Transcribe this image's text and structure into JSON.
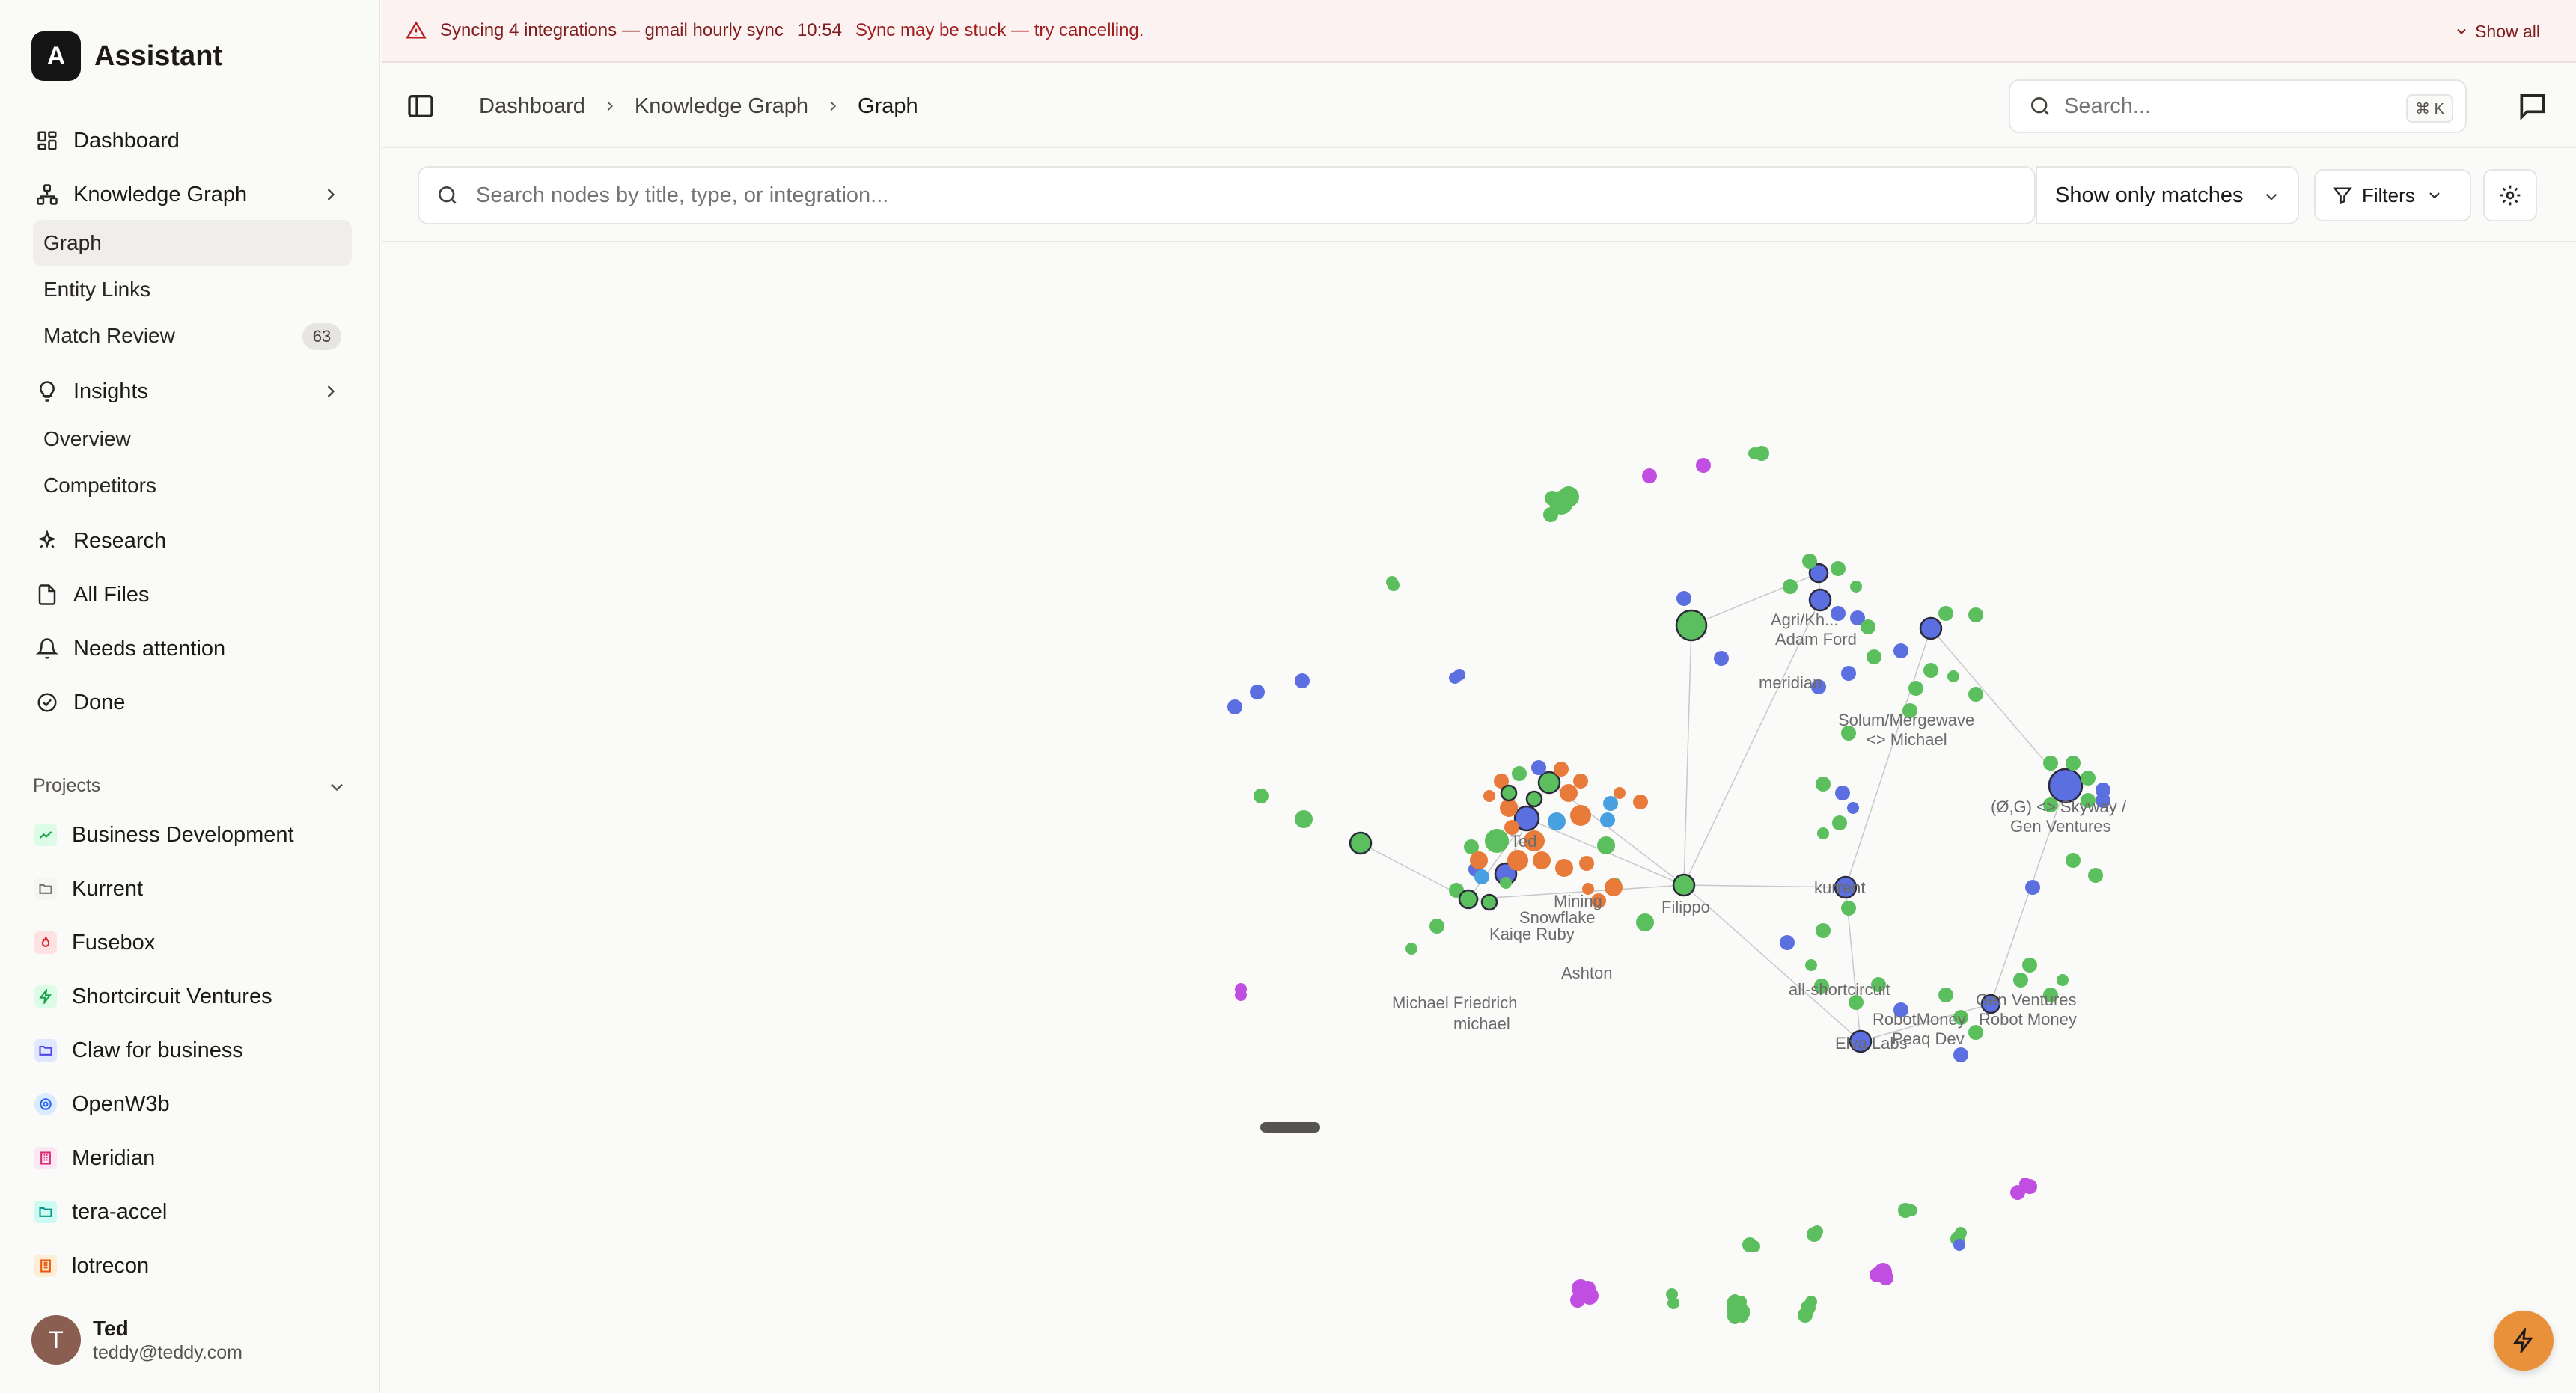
{
  "app": {
    "logo_letter": "A",
    "name": "Assistant"
  },
  "sidebar": {
    "nav": [
      {
        "label": "Dashboard",
        "icon": "dashboard-icon"
      },
      {
        "label": "Knowledge Graph",
        "icon": "graph-icon"
      },
      {
        "label": "Insights",
        "icon": "lightbulb-icon"
      },
      {
        "label": "Research",
        "icon": "sparkle-icon"
      },
      {
        "label": "All Files",
        "icon": "file-icon"
      },
      {
        "label": "Needs attention",
        "icon": "bell-icon"
      },
      {
        "label": "Done",
        "icon": "check-circle-icon"
      }
    ],
    "kg_sub": [
      {
        "label": "Graph"
      },
      {
        "label": "Entity Links"
      },
      {
        "label": "Match Review",
        "badge": "63"
      }
    ],
    "insights_sub": [
      {
        "label": "Overview"
      },
      {
        "label": "Competitors"
      }
    ],
    "projects_label": "Projects",
    "projects": [
      {
        "label": "Business Development",
        "color": "#16a34a"
      },
      {
        "label": "Kurrent",
        "color": "#78716c"
      },
      {
        "label": "Fusebox",
        "color": "#dc2626"
      },
      {
        "label": "Shortcircuit Ventures",
        "color": "#16a34a"
      },
      {
        "label": "Claw for business",
        "color": "#4f46e5"
      },
      {
        "label": "OpenW3b",
        "color": "#2563eb"
      },
      {
        "label": "Meridian",
        "color": "#db2777"
      },
      {
        "label": "tera-accel",
        "color": "#0d9488"
      },
      {
        "label": "lotrecon",
        "color": "#ea580c"
      }
    ],
    "user": {
      "initial": "T",
      "name": "Ted",
      "email": "teddy@teddy.com"
    }
  },
  "banner": {
    "title": "Syncing 4 integrations — gmail hourly sync",
    "time": "10:54",
    "message": "Sync may be stuck — try cancelling.",
    "show_all": "Show all"
  },
  "breadcrumb": [
    "Dashboard",
    "Knowledge Graph",
    "Graph"
  ],
  "global_search": {
    "placeholder": "Search...",
    "shortcut": "⌘ K"
  },
  "node_search": {
    "placeholder": "Search nodes by title, type, or integration..."
  },
  "match_mode": "Show only matches",
  "filters_label": "Filters",
  "colors": {
    "green": "#5cbf5e",
    "blue": "#5b6fe0",
    "orange": "#e87a3a",
    "purple": "#c04ee0",
    "lightblue": "#48a0e0",
    "accent": "#e8913a"
  },
  "graph": {
    "labels": [
      "Agri/Kh...",
      "Adam Ford",
      "meridian",
      "Solum/Mergewave",
      "<> Michael",
      "(Ø,G) <> Skyway /",
      "Gen Ventures",
      "kurrent",
      "Filippo",
      "all-shortcircuit",
      "RobotMoney",
      "Peaq Dev",
      "Elva Labs",
      "Gen Ventures",
      "Robot Money",
      "Ted",
      "Mining",
      "Snowflake",
      "Kaiqe Ruby",
      "Ashton",
      "Michael Friedrich",
      "michael"
    ]
  }
}
